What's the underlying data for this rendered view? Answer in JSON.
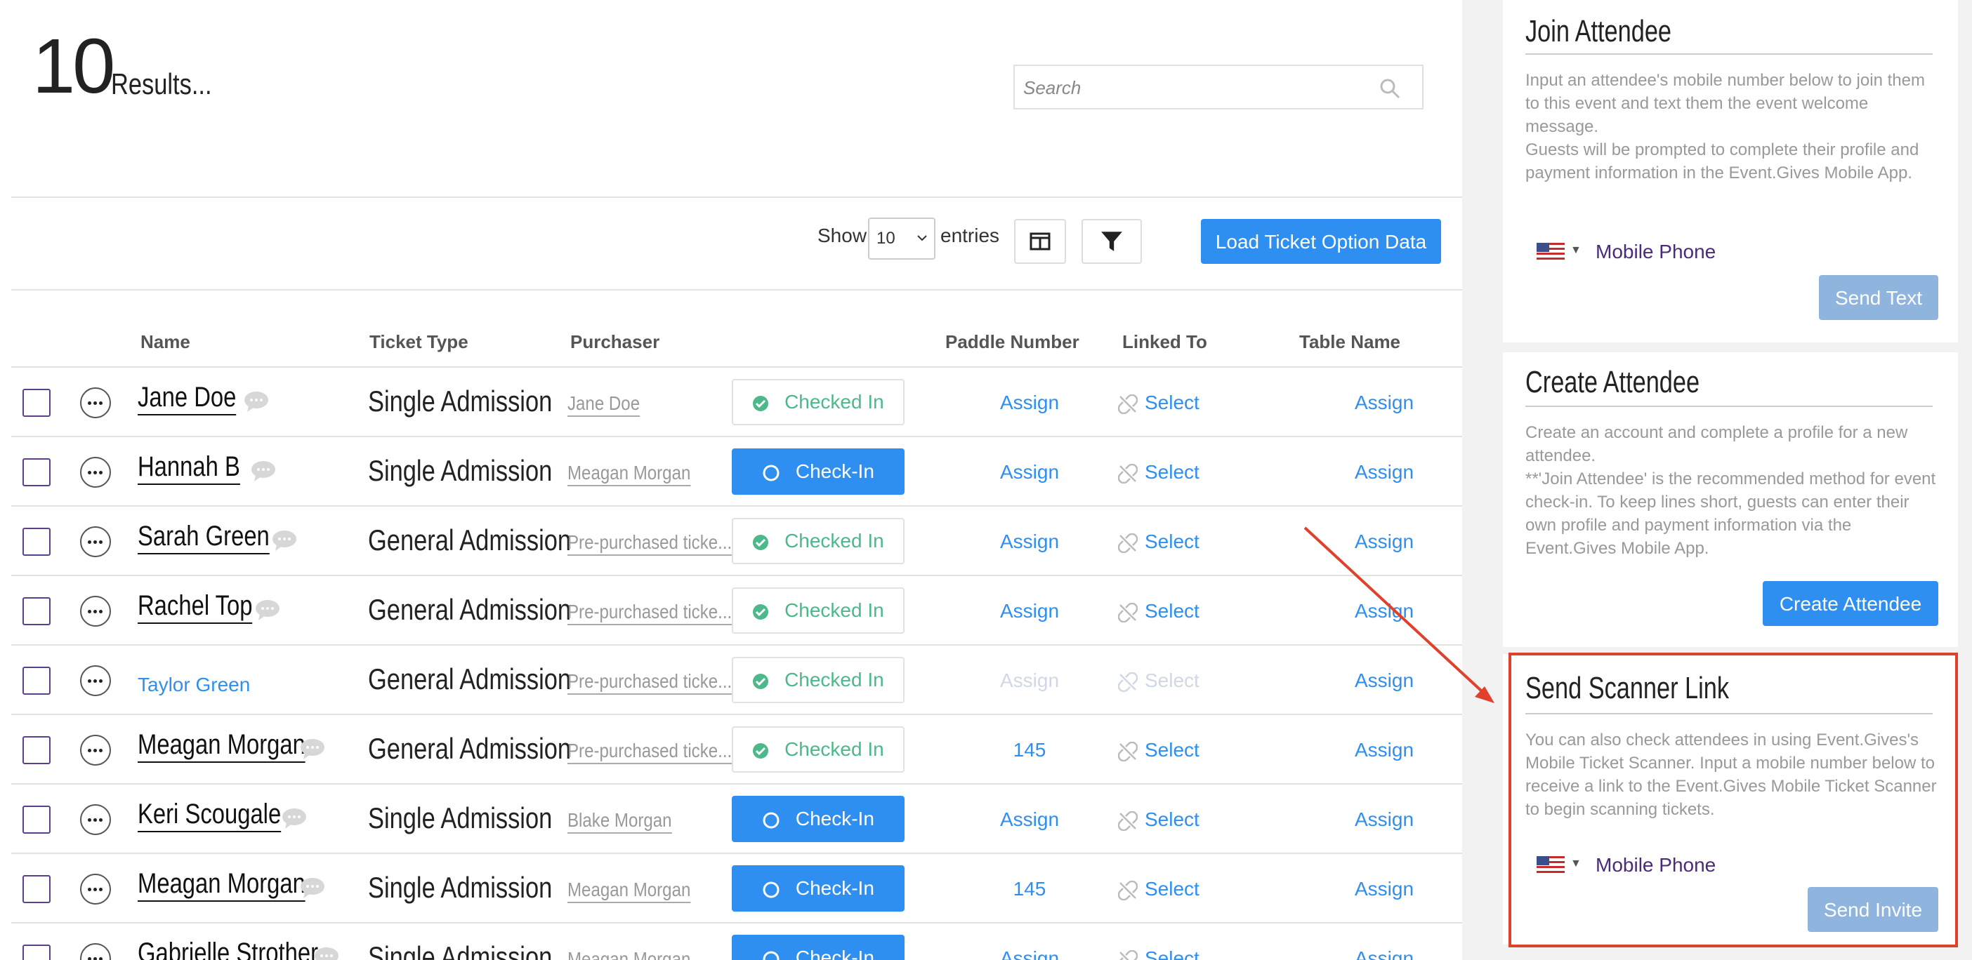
{
  "results": {
    "count": "10",
    "label": "Results..."
  },
  "search": {
    "placeholder": "Search"
  },
  "toolbar": {
    "show_label": "Show",
    "entries_value": "10",
    "entries_label": "entries",
    "load_button": "Load Ticket Option Data"
  },
  "columns": {
    "name": "Name",
    "ticket_type": "Ticket Type",
    "purchaser": "Purchaser",
    "paddle": "Paddle Number",
    "linked": "Linked To",
    "table": "Table Name"
  },
  "rows": [
    {
      "name": "Jane Doe",
      "ticket_type": "Single Admission",
      "purchaser": "Jane Doe",
      "status": "Checked In",
      "paddle": "Assign",
      "linked": "Select",
      "table": "Assign"
    },
    {
      "name": "Hannah B",
      "ticket_type": "Single Admission",
      "purchaser": "Meagan Morgan",
      "status": "Check-In",
      "paddle": "Assign",
      "linked": "Select",
      "table": "Assign"
    },
    {
      "name": "Sarah Green",
      "ticket_type": "General Admission",
      "purchaser": "Pre-purchased ticke...",
      "status": "Checked In",
      "paddle": "Assign",
      "linked": "Select",
      "table": "Assign"
    },
    {
      "name": "Rachel Top",
      "ticket_type": "General Admission",
      "purchaser": "Pre-purchased ticke...",
      "status": "Checked In",
      "paddle": "Assign",
      "linked": "Select",
      "table": "Assign"
    },
    {
      "name": "Taylor Green",
      "ticket_type": "General Admission",
      "purchaser": "Pre-purchased ticke...",
      "status": "Checked In",
      "paddle": "Assign",
      "linked": "Select",
      "table": "Assign"
    },
    {
      "name": "Meagan Morgan",
      "ticket_type": "General Admission",
      "purchaser": "Pre-purchased ticke...",
      "status": "Checked In",
      "paddle": "145",
      "linked": "Select",
      "table": "Assign"
    },
    {
      "name": "Keri Scougale",
      "ticket_type": "Single Admission",
      "purchaser": "Blake Morgan",
      "status": "Check-In",
      "paddle": "Assign",
      "linked": "Select",
      "table": "Assign"
    },
    {
      "name": "Meagan Morgan",
      "ticket_type": "Single Admission",
      "purchaser": "Meagan Morgan",
      "status": "Check-In",
      "paddle": "145",
      "linked": "Select",
      "table": "Assign"
    },
    {
      "name": "Gabrielle Strother",
      "ticket_type": "Single Admission",
      "purchaser": "Meagan Morgan",
      "status": "Check-In",
      "paddle": "Assign",
      "linked": "Select",
      "table": "Assign"
    }
  ],
  "join_attendee": {
    "title": "Join Attendee",
    "desc1": "Input an attendee's mobile number below to join them to this event and text them the event welcome message.",
    "desc2": "Guests will be prompted to complete their profile and payment information in the Event.Gives Mobile App.",
    "phone_placeholder": "Mobile Phone",
    "button": "Send Text"
  },
  "create_attendee": {
    "title": "Create Attendee",
    "desc1": "Create an account and complete a profile for a new attendee.",
    "desc2": "**'Join Attendee' is the recommended method for event check-in. To keep lines short, guests can enter their own profile and payment information via the Event.Gives Mobile App.",
    "button": "Create Attendee"
  },
  "scanner_link": {
    "title": "Send Scanner Link",
    "desc": "You can also check attendees in using Event.Gives's Mobile Ticket Scanner. Input a mobile number below to receive a link to the Event.Gives Mobile Ticket Scanner to begin scanning tickets.",
    "phone_placeholder": "Mobile Phone",
    "button": "Send Invite"
  },
  "colors": {
    "primary": "#2f8ff0",
    "checked": "#4db88a",
    "highlight": "#e0412c",
    "muted_button": "#8fb5df"
  }
}
